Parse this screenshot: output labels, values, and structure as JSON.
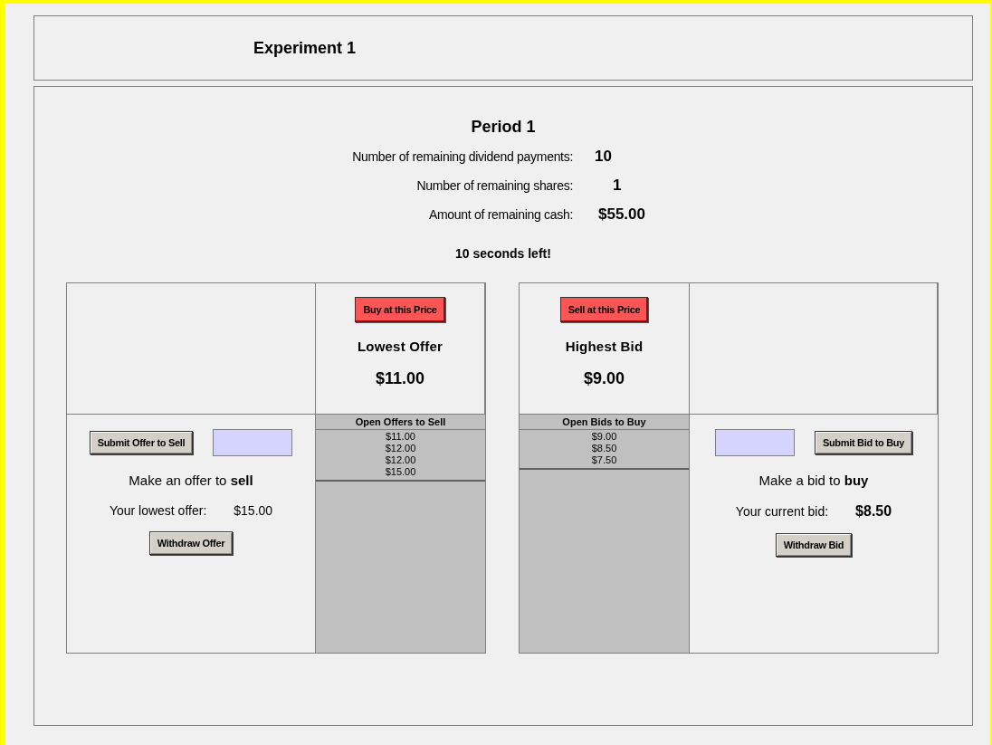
{
  "header": {
    "title": "Experiment 1"
  },
  "period": "Period 1",
  "stats": [
    {
      "label": "Number of remaining dividend payments:",
      "value": "10"
    },
    {
      "label": "Number of remaining shares:",
      "value": "1"
    },
    {
      "label": "Amount of remaining cash:",
      "value": "$55.00"
    }
  ],
  "timer": "10 seconds left!",
  "sell_side": {
    "quote_button": "Buy at this Price",
    "quote_label": "Lowest Offer",
    "quote_value": "$11.00",
    "list_title": "Open Offers to Sell",
    "list": [
      "$11.00",
      "$12.00",
      "$12.00",
      "$15.00"
    ],
    "submit_button": "Submit Offer to Sell",
    "prompt": "Make an offer to **sell**",
    "own_label": "Your lowest offer:",
    "own_value": "$15.00",
    "withdraw_button": "Withdraw Offer"
  },
  "buy_side": {
    "quote_button": "Sell at this Price",
    "quote_label": "Highest Bid",
    "quote_value": "$9.00",
    "list_title": "Open Bids to Buy",
    "list": [
      "$9.00",
      "$8.50",
      "$7.50"
    ],
    "submit_button": "Submit Bid to Buy",
    "prompt": "Make a bid to **buy**",
    "own_label": "Your current bid:",
    "own_value": "$8.50",
    "withdraw_button": "Withdraw Bid"
  }
}
